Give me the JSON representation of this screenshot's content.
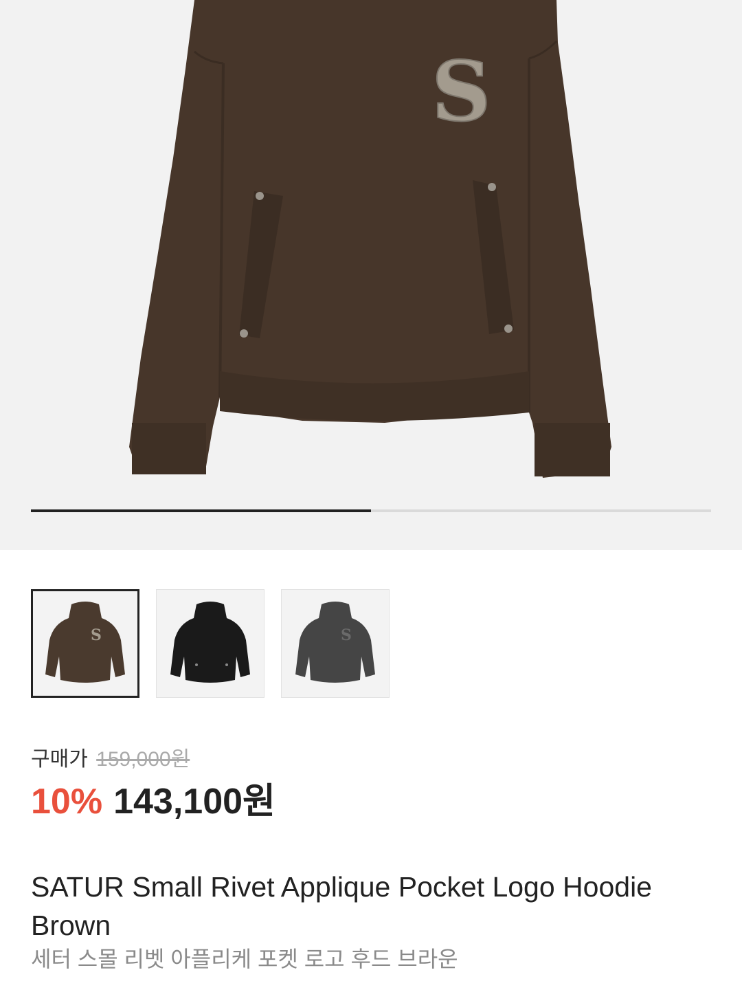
{
  "gallery": {
    "progress": 0.5,
    "thumbnails": [
      {
        "color_name": "Brown",
        "hex": "#4a3a2e",
        "selected": true,
        "logo": true
      },
      {
        "color_name": "Black",
        "hex": "#1a1a1a",
        "selected": false,
        "logo": false
      },
      {
        "color_name": "Charcoal",
        "hex": "#454545",
        "selected": false,
        "logo": true
      }
    ]
  },
  "price": {
    "label": "구매가",
    "original": "159,000원",
    "discount": "10%",
    "sale": "143,100원"
  },
  "product": {
    "title": "SATUR Small Rivet Applique Pocket Logo Hoodie Brown",
    "subtitle": "세터 스몰 리벳 아플리케 포켓 로고 후드 브라운"
  },
  "colors": {
    "hoodie": "#47362a",
    "hoodie_shadow": "#392b21",
    "patch": "#a39b8e",
    "discount": "#e9503c"
  }
}
